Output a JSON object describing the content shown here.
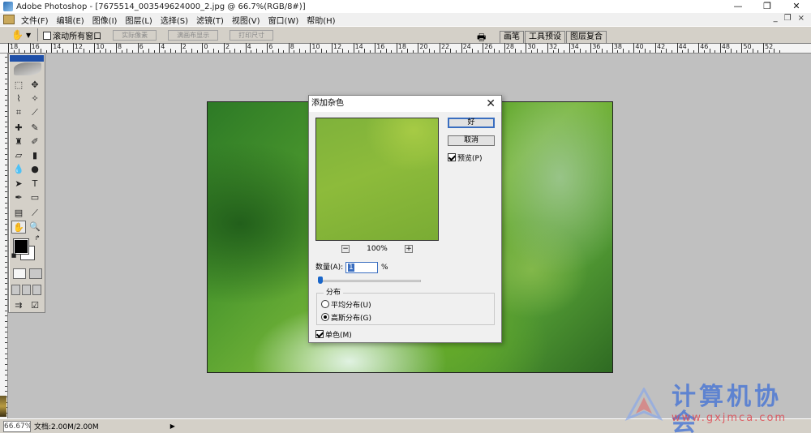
{
  "window": {
    "app_title": "Adobe Photoshop - [7675514_003549624000_2.jpg @ 66.7%(RGB/8#)]",
    "minimize": "—",
    "restore": "❐",
    "close": "✕"
  },
  "menu": {
    "items": [
      "文件(F)",
      "编辑(E)",
      "图像(I)",
      "图层(L)",
      "选择(S)",
      "滤镜(T)",
      "视图(V)",
      "窗口(W)",
      "帮助(H)"
    ],
    "doc_minimize": "_",
    "doc_restore": "❐",
    "doc_close": "×"
  },
  "options_bar": {
    "scroll_all_label": "滚动所有窗口",
    "actual_pixels": "实际像素",
    "fit_screen": "满画布显示",
    "print_size": "打印尺寸"
  },
  "palette_well": {
    "tabs": [
      "画笔",
      "工具预设",
      "图层复合"
    ]
  },
  "ruler": {
    "top_labels": [
      "18",
      "16",
      "14",
      "12",
      "10",
      "8",
      "6",
      "4",
      "2",
      "0",
      "2",
      "4",
      "6",
      "8",
      "10",
      "12",
      "14",
      "16",
      "18",
      "20",
      "22",
      "24",
      "26",
      "28",
      "30",
      "32",
      "34",
      "36",
      "38",
      "40",
      "42",
      "44",
      "46",
      "48",
      "50",
      "52"
    ]
  },
  "status_bar": {
    "zoom": "66.67%",
    "doc_size": "文档:2.00M/2.00M",
    "arrow": "▶"
  },
  "dialog": {
    "title": "添加杂色",
    "ok_label": "好",
    "cancel_label": "取消",
    "preview_label": "预览(P)",
    "zoom_level": "100%",
    "zoom_minus": "−",
    "zoom_plus": "+",
    "amount_label": "数量(A):",
    "amount_value": "1",
    "amount_unit": "%",
    "distribution_label": "分布",
    "uniform_label": "平均分布(U)",
    "gaussian_label": "高斯分布(G)",
    "monochromatic_label": "单色(M)",
    "amount_slider_fraction": 0.01
  },
  "watermark": {
    "title": "计算机协会",
    "url": "www.gxjmca.com"
  },
  "colors": {
    "title_blue": "#1e4fa8",
    "accent": "#3a6ec0",
    "watermark_blue": "#3e6fd6",
    "watermark_red": "#e0404a"
  }
}
